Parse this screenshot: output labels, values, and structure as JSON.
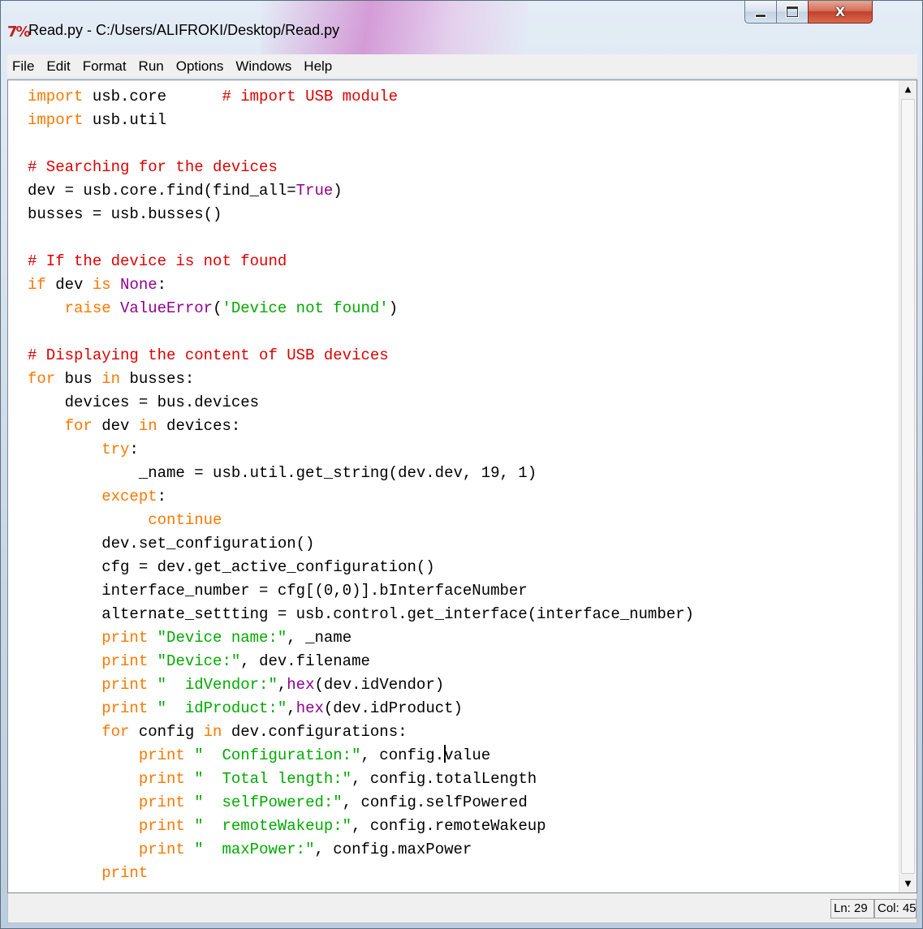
{
  "window": {
    "title": "Read.py - C:/Users/ALIFROKI/Desktop/Read.py",
    "app_icon_text": "7%",
    "controls": {
      "minimize_glyph": "minimize",
      "maximize_glyph": "maximize",
      "close_label": "X"
    }
  },
  "menu": {
    "items": [
      "File",
      "Edit",
      "Format",
      "Run",
      "Options",
      "Windows",
      "Help"
    ]
  },
  "editor": {
    "language": "Python",
    "cursor": {
      "line": 29,
      "column": 45
    },
    "lines": [
      [
        {
          "t": "import",
          "c": "kw"
        },
        {
          "t": " usb.core      "
        },
        {
          "t": "# import USB module",
          "c": "cm"
        }
      ],
      [
        {
          "t": "import",
          "c": "kw"
        },
        {
          "t": " usb.util"
        }
      ],
      [],
      [
        {
          "t": "# Searching for the devices",
          "c": "cm"
        }
      ],
      [
        {
          "t": "dev = usb.core.find(find_all="
        },
        {
          "t": "True",
          "c": "bi"
        },
        {
          "t": ")"
        }
      ],
      [
        {
          "t": "busses = usb.busses()"
        }
      ],
      [],
      [
        {
          "t": "# If the device is not found",
          "c": "cm"
        }
      ],
      [
        {
          "t": "if",
          "c": "kw"
        },
        {
          "t": " dev "
        },
        {
          "t": "is",
          "c": "kw"
        },
        {
          "t": " "
        },
        {
          "t": "None",
          "c": "bi"
        },
        {
          "t": ":"
        }
      ],
      [
        {
          "t": "    "
        },
        {
          "t": "raise",
          "c": "kw"
        },
        {
          "t": " "
        },
        {
          "t": "ValueError",
          "c": "bi"
        },
        {
          "t": "("
        },
        {
          "t": "'Device not found'",
          "c": "st"
        },
        {
          "t": ")"
        }
      ],
      [],
      [
        {
          "t": "# Displaying the content of USB devices",
          "c": "cm"
        }
      ],
      [
        {
          "t": "for",
          "c": "kw"
        },
        {
          "t": " bus "
        },
        {
          "t": "in",
          "c": "kw"
        },
        {
          "t": " busses:"
        }
      ],
      [
        {
          "t": "    devices = bus.devices"
        }
      ],
      [
        {
          "t": "    "
        },
        {
          "t": "for",
          "c": "kw"
        },
        {
          "t": " dev "
        },
        {
          "t": "in",
          "c": "kw"
        },
        {
          "t": " devices:"
        }
      ],
      [
        {
          "t": "        "
        },
        {
          "t": "try",
          "c": "kw"
        },
        {
          "t": ":"
        }
      ],
      [
        {
          "t": "            _name = usb.util.get_string(dev.dev, 19, 1)"
        }
      ],
      [
        {
          "t": "        "
        },
        {
          "t": "except",
          "c": "kw"
        },
        {
          "t": ":"
        }
      ],
      [
        {
          "t": "             "
        },
        {
          "t": "continue",
          "c": "kw"
        }
      ],
      [
        {
          "t": "        dev.set_configuration()"
        }
      ],
      [
        {
          "t": "        cfg = dev.get_active_configuration()"
        }
      ],
      [
        {
          "t": "        interface_number = cfg[(0,0)].bInterfaceNumber"
        }
      ],
      [
        {
          "t": "        alternate_settting = usb.control.get_interface(interface_number)"
        }
      ],
      [
        {
          "t": "        "
        },
        {
          "t": "print",
          "c": "kw"
        },
        {
          "t": " "
        },
        {
          "t": "\"Device name:\"",
          "c": "st"
        },
        {
          "t": ", _name"
        }
      ],
      [
        {
          "t": "        "
        },
        {
          "t": "print",
          "c": "kw"
        },
        {
          "t": " "
        },
        {
          "t": "\"Device:\"",
          "c": "st"
        },
        {
          "t": ", dev.filename"
        }
      ],
      [
        {
          "t": "        "
        },
        {
          "t": "print",
          "c": "kw"
        },
        {
          "t": " "
        },
        {
          "t": "\"  idVendor:\"",
          "c": "st"
        },
        {
          "t": ","
        },
        {
          "t": "hex",
          "c": "bi"
        },
        {
          "t": "(dev.idVendor)"
        }
      ],
      [
        {
          "t": "        "
        },
        {
          "t": "print",
          "c": "kw"
        },
        {
          "t": " "
        },
        {
          "t": "\"  idProduct:\"",
          "c": "st"
        },
        {
          "t": ","
        },
        {
          "t": "hex",
          "c": "bi"
        },
        {
          "t": "(dev.idProduct)"
        }
      ],
      [
        {
          "t": "        "
        },
        {
          "t": "for",
          "c": "kw"
        },
        {
          "t": " config "
        },
        {
          "t": "in",
          "c": "kw"
        },
        {
          "t": " dev.configurations:"
        }
      ],
      [
        {
          "t": "            "
        },
        {
          "t": "print",
          "c": "kw"
        },
        {
          "t": " "
        },
        {
          "t": "\"  Configuration:\"",
          "c": "st"
        },
        {
          "t": ", config."
        },
        {
          "caret": true
        },
        {
          "t": "value"
        }
      ],
      [
        {
          "t": "            "
        },
        {
          "t": "print",
          "c": "kw"
        },
        {
          "t": " "
        },
        {
          "t": "\"  Total length:\"",
          "c": "st"
        },
        {
          "t": ", config.totalLength"
        }
      ],
      [
        {
          "t": "            "
        },
        {
          "t": "print",
          "c": "kw"
        },
        {
          "t": " "
        },
        {
          "t": "\"  selfPowered:\"",
          "c": "st"
        },
        {
          "t": ", config.selfPowered"
        }
      ],
      [
        {
          "t": "            "
        },
        {
          "t": "print",
          "c": "kw"
        },
        {
          "t": " "
        },
        {
          "t": "\"  remoteWakeup:\"",
          "c": "st"
        },
        {
          "t": ", config.remoteWakeup"
        }
      ],
      [
        {
          "t": "            "
        },
        {
          "t": "print",
          "c": "kw"
        },
        {
          "t": " "
        },
        {
          "t": "\"  maxPower:\"",
          "c": "st"
        },
        {
          "t": ", config.maxPower"
        }
      ],
      [
        {
          "t": "        "
        },
        {
          "t": "print",
          "c": "kw"
        }
      ]
    ]
  },
  "status": {
    "line": "Ln: 29",
    "column": "Col: 45"
  },
  "colors": {
    "keyword": "#ff7700",
    "comment": "#dd0000",
    "string": "#00aa00",
    "builtin": "#900090",
    "default": "#000000"
  }
}
